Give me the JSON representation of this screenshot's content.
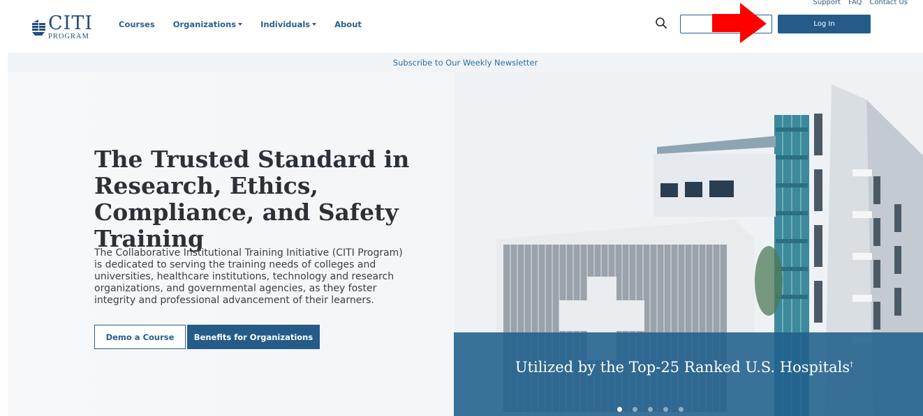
{
  "utility_links": [
    "Support",
    "FAQ",
    "Contact Us"
  ],
  "logo": {
    "main": "CITI",
    "sub": "PROGRAM"
  },
  "nav": [
    {
      "label": "Courses",
      "dropdown": false
    },
    {
      "label": "Organizations",
      "dropdown": true
    },
    {
      "label": "Individuals",
      "dropdown": true
    },
    {
      "label": "About",
      "dropdown": false
    }
  ],
  "header": {
    "register_label": "Regis",
    "login_label": "Log In"
  },
  "newsletter": {
    "text": "Subscribe to Our Weekly Newsletter"
  },
  "hero": {
    "title": "The Trusted Standard in Research, Ethics, Compliance, and Safety Training",
    "description": "The Collaborative Institutional Training Initiative (CITI Program) is dedicated to serving the training needs of colleges and universities, healthcare institutions, technology and research organizations, and governmental agencies, as they foster integrity and professional advancement of their learners.",
    "demo_label": "Demo a Course",
    "benefits_label": "Benefits for Organizations"
  },
  "carousel": {
    "caption": "Utilized by the Top-25 Ranked U.S. Hospitals",
    "caption_mark": "†",
    "slide_count": 5,
    "active_index": 0
  },
  "colors": {
    "brand_blue": "#245b88",
    "link_blue": "#2a5f8e",
    "arrow_red": "#ff0000"
  },
  "icons": {
    "search": "search-icon",
    "arrow": "red-arrow-annotation",
    "caret": "caret-down-icon"
  }
}
